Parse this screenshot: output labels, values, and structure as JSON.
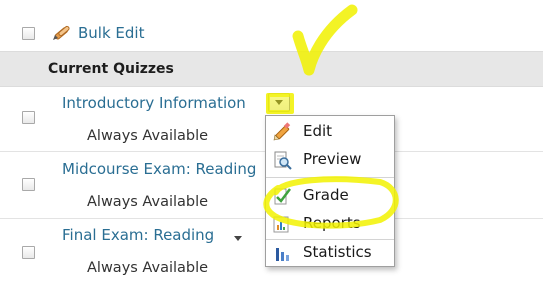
{
  "toolbar": {
    "bulk_edit_label": "Bulk Edit"
  },
  "section": {
    "title": "Current Quizzes"
  },
  "quizzes": [
    {
      "title": "Introductory Information",
      "availability": "Always Available"
    },
    {
      "title": "Midcourse Exam: Reading",
      "availability": "Always Available"
    },
    {
      "title": "Final Exam: Reading",
      "availability": "Always Available"
    }
  ],
  "menu": {
    "items": [
      {
        "label": "Edit",
        "icon": "pencil-icon"
      },
      {
        "label": "Preview",
        "icon": "preview-icon"
      },
      {
        "label": "Grade",
        "icon": "grade-icon"
      },
      {
        "label": "Reports",
        "icon": "reports-icon"
      },
      {
        "label": "Statistics",
        "icon": "statistics-icon"
      }
    ]
  },
  "colors": {
    "link": "#2a6e93",
    "header_bg": "#e7e7e7",
    "highlight": "#f2f200"
  }
}
